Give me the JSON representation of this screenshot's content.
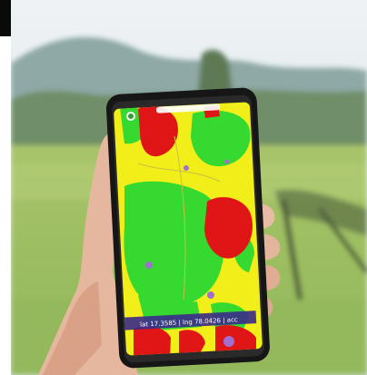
{
  "photo": {
    "subject": "hand holding smartphone showing land-use map over blurred field background",
    "status_text": "lat 17.3585 | lng 78.0426 | acc"
  },
  "colors": {
    "sky": "#dfe8ee",
    "hill": "#8aa6a2",
    "field": "#9fc163",
    "skin": "#e4b59d",
    "phone": "#151515",
    "map_yellow": "#f2ee1a",
    "map_green": "#35d92f",
    "map_red": "#e01616",
    "map_purple": "#a070d0",
    "status_bg": "#3a2a8a"
  }
}
